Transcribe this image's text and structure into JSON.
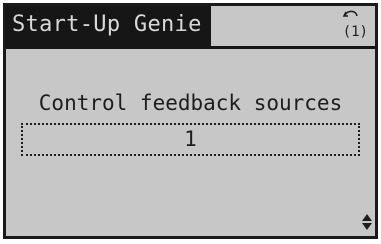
{
  "header": {
    "title": "Start-Up Genie",
    "back_label": "(1)"
  },
  "parameter": {
    "name": "Control feedback sources",
    "value": "1"
  },
  "icons": {
    "back": "back-arrow-icon",
    "updown": "up-down-arrows-icon"
  },
  "colors": {
    "screen_background": "#c7c7c7",
    "title_background": "#161616",
    "title_text": "#d8d8d8",
    "foreground": "#1e1e1e"
  }
}
